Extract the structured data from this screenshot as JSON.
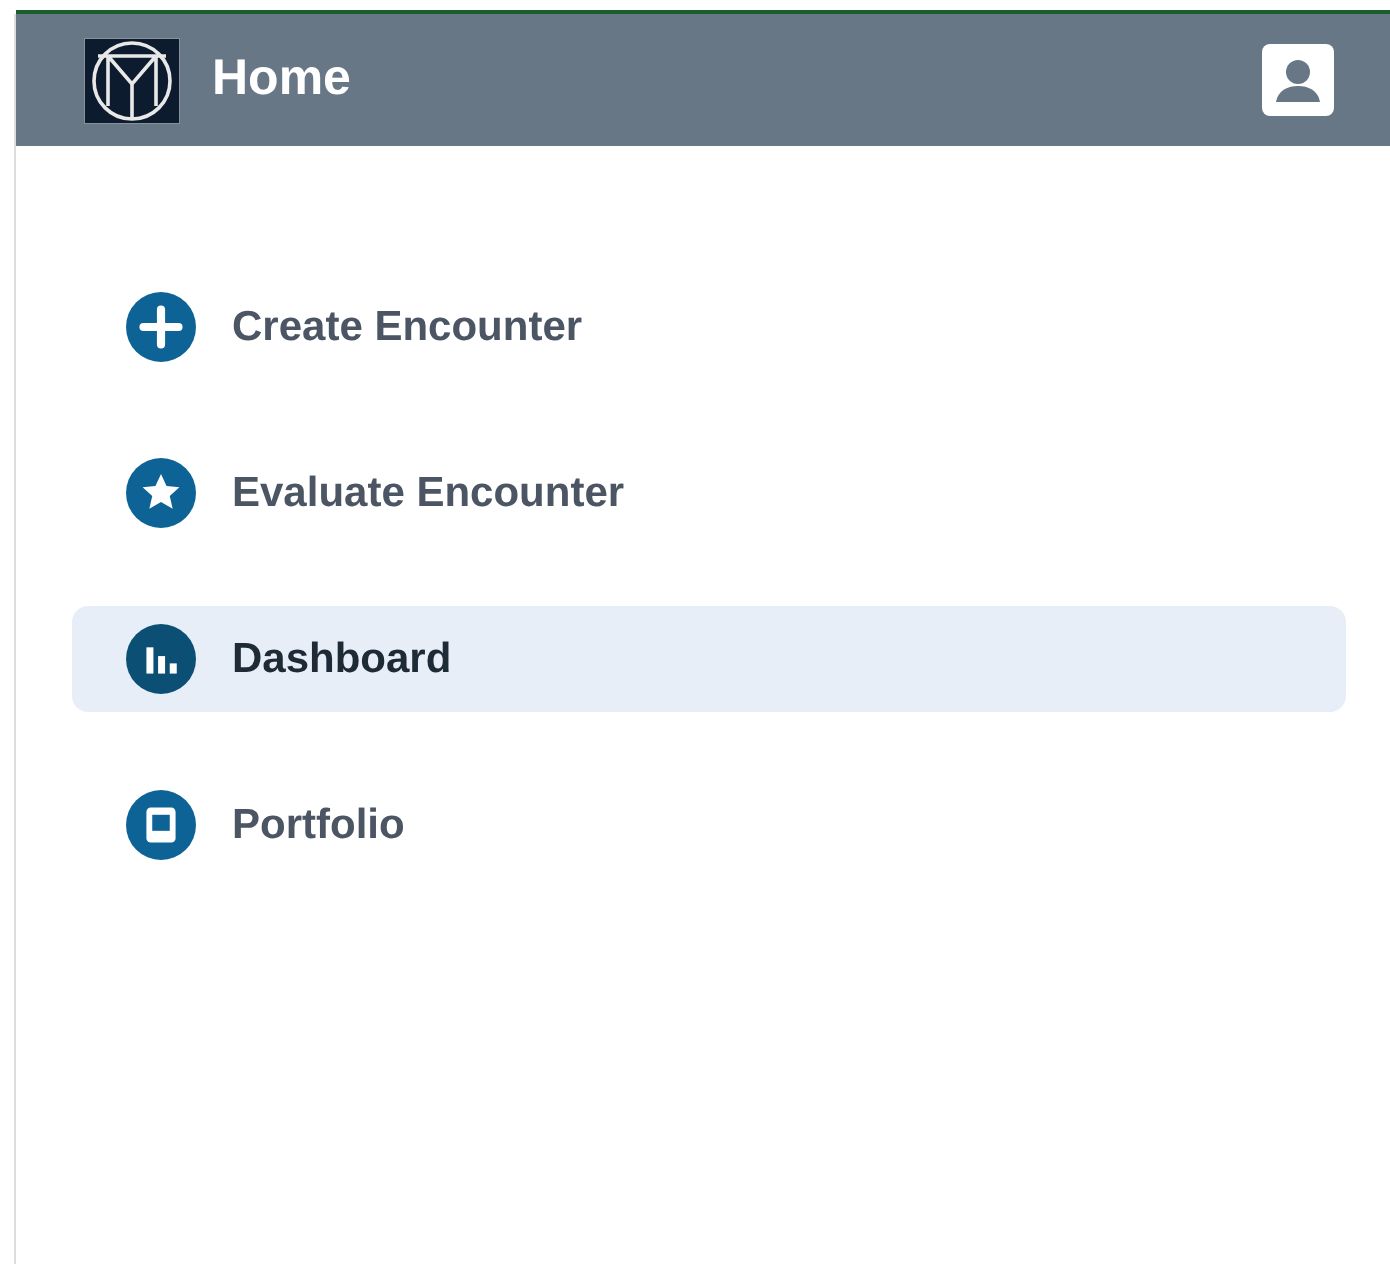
{
  "header": {
    "title": "Home"
  },
  "menu": [
    {
      "kind": "plus",
      "label": "Create Encounter",
      "selected": false
    },
    {
      "kind": "star",
      "label": "Evaluate Encounter",
      "selected": false
    },
    {
      "kind": "chart",
      "label": "Dashboard",
      "selected": true
    },
    {
      "kind": "book",
      "label": "Portfolio",
      "selected": false
    }
  ]
}
